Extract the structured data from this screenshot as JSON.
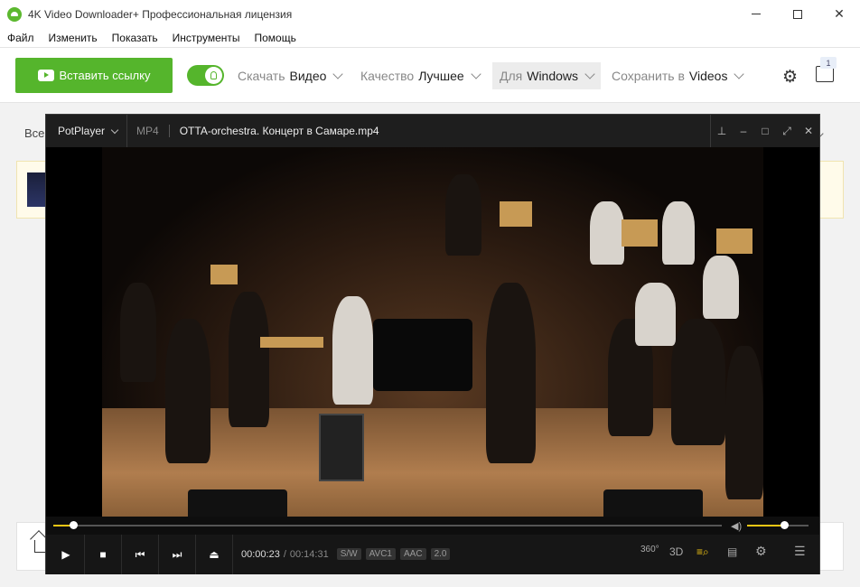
{
  "app": {
    "title": "4K Video Downloader+ Профессиональная лицензия",
    "brand_color": "#55b52c"
  },
  "menu": [
    "Файл",
    "Изменить",
    "Показать",
    "Инструменты",
    "Помощь"
  ],
  "toolbar": {
    "paste_label": "Вставить ссылку",
    "smart_mode_on": true,
    "download": {
      "label": "Скачать",
      "value": "Видео"
    },
    "quality": {
      "label": "Качество",
      "value": "Лучшее"
    },
    "platform": {
      "label": "Для",
      "value": "Windows"
    },
    "save": {
      "label": "Сохранить в",
      "value": "Videos"
    },
    "subscriptions_badge": "1"
  },
  "list": {
    "header_partial": "Все"
  },
  "player": {
    "brand": "PotPlayer",
    "format": "MP4",
    "filename": "OTTA-orchestra. Концерт в Самаре.mp4",
    "title_controls": [
      "pin-icon",
      "minimize-icon",
      "maximize-icon",
      "fullscreen-icon",
      "close-icon"
    ],
    "progress": 0.03,
    "volume": 0.6,
    "time_current": "00:00:23",
    "time_separator": "/",
    "time_total": "00:14:31",
    "tags": [
      "S/W",
      "AVC1",
      "AAC",
      "2.0"
    ],
    "right_icons": {
      "vr": "360°",
      "three_d": "3D"
    },
    "accent_color": "#f2c614"
  }
}
